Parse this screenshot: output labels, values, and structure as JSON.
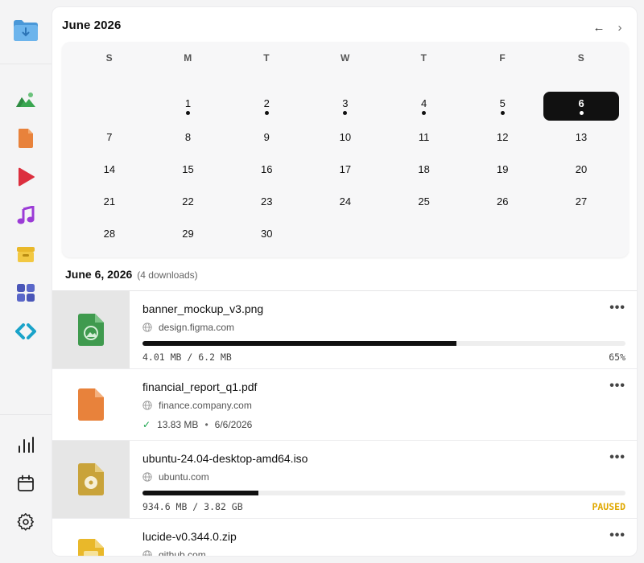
{
  "sidebar": {
    "top_icon": "folder-download-icon",
    "items": [
      {
        "icon": "images-icon"
      },
      {
        "icon": "document-icon"
      },
      {
        "icon": "video-icon"
      },
      {
        "icon": "music-icon"
      },
      {
        "icon": "archive-icon"
      },
      {
        "icon": "apps-icon"
      },
      {
        "icon": "code-icon"
      }
    ],
    "bottom": [
      {
        "icon": "stats-icon"
      },
      {
        "icon": "calendar-icon"
      },
      {
        "icon": "settings-icon"
      }
    ]
  },
  "calendar": {
    "month_title": "June 2026",
    "prev_symbol": "←",
    "next_symbol": "›",
    "weekdays": [
      "S",
      "M",
      "T",
      "W",
      "T",
      "F",
      "S"
    ],
    "weeks": [
      [
        "",
        "1",
        "2",
        "3",
        "4",
        "5",
        "6"
      ],
      [
        "7",
        "8",
        "9",
        "10",
        "11",
        "12",
        "13"
      ],
      [
        "14",
        "15",
        "16",
        "17",
        "18",
        "19",
        "20"
      ],
      [
        "21",
        "22",
        "23",
        "24",
        "25",
        "26",
        "27"
      ],
      [
        "28",
        "29",
        "30",
        "",
        "",
        "",
        ""
      ]
    ],
    "days_with_downloads": [
      "1",
      "2",
      "3",
      "4",
      "5",
      "6"
    ],
    "selected_day": "6"
  },
  "downloads": {
    "date_label": "June 6, 2026",
    "count_label": "(4 downloads)",
    "more_symbol": "•••",
    "items": [
      {
        "filename": "banner_mockup_v3.png",
        "domain": "design.figma.com",
        "status": "downloading",
        "progress": 0.65,
        "size_text": "4.01 MB / 6.2 MB",
        "status_text": "65%",
        "thumb": "image-file-icon"
      },
      {
        "filename": "financial_report_q1.pdf",
        "domain": "finance.company.com",
        "status": "completed",
        "size_text": "13.83 MB",
        "date_text": "6/6/2026",
        "thumb": "pdf-file-icon"
      },
      {
        "filename": "ubuntu-24.04-desktop-amd64.iso",
        "domain": "ubuntu.com",
        "status": "paused",
        "progress": 0.24,
        "size_text": "934.6 MB / 3.82 GB",
        "status_text": "PAUSED",
        "thumb": "disk-image-file-icon"
      },
      {
        "filename": "lucide-v0.344.0.zip",
        "domain": "github.com",
        "status": "unknown",
        "thumb": "archive-file-icon"
      }
    ]
  },
  "colors": {
    "accent": "#111111",
    "paused": "#e0a800",
    "success": "#16a34a"
  }
}
